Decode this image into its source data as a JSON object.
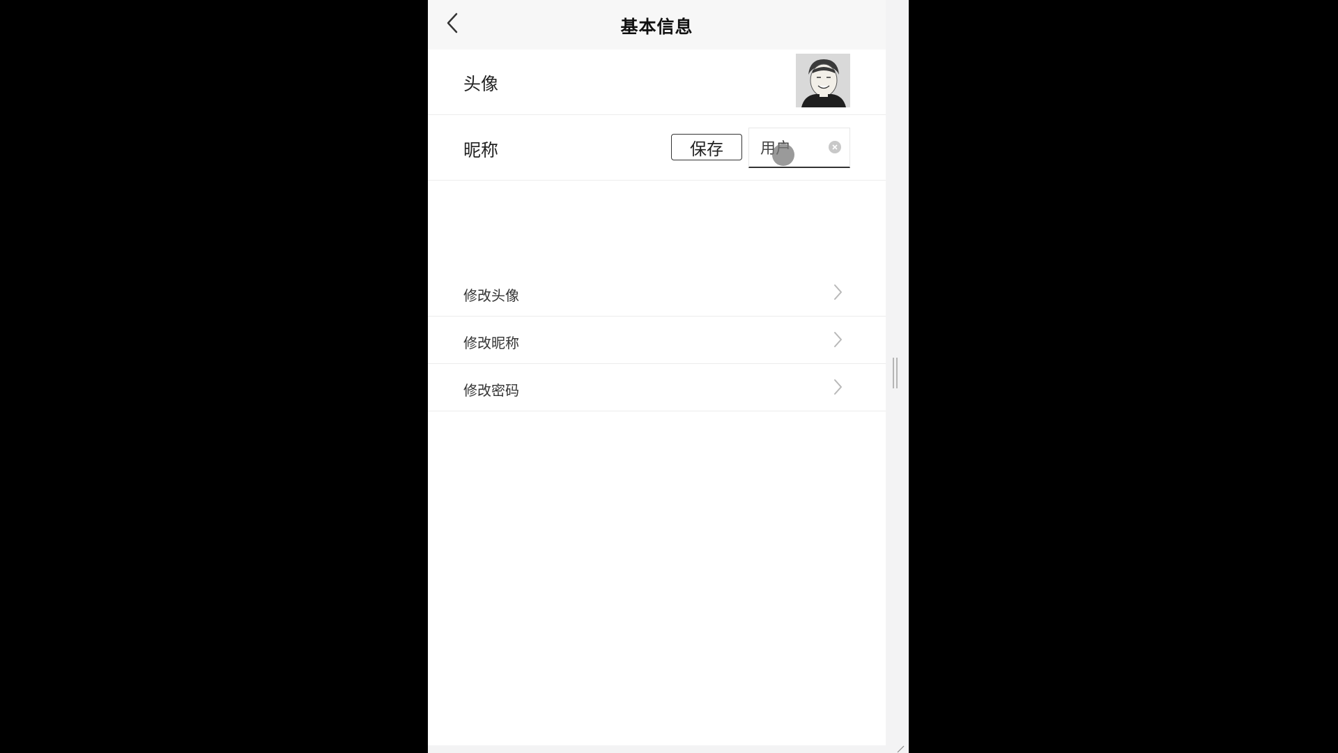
{
  "navbar": {
    "title": "基本信息",
    "back_icon": "chevron-left-icon"
  },
  "profile": {
    "avatar_label": "头像",
    "avatar_icon": "avatar-image",
    "nickname_label": "昵称",
    "save_label": "保存",
    "nickname_value": "用户",
    "clear_icon": "clear-circle-icon"
  },
  "menu": {
    "items": [
      {
        "label": "修改头像",
        "icon": "chevron-right-icon"
      },
      {
        "label": "修改昵称",
        "icon": "chevron-right-icon"
      },
      {
        "label": "修改密码",
        "icon": "chevron-right-icon"
      }
    ]
  },
  "colors": {
    "background": "#000000",
    "frame": "#f3f3f4",
    "navbar": "#f7f7f7",
    "divider": "#ececec",
    "text": "#222222"
  }
}
